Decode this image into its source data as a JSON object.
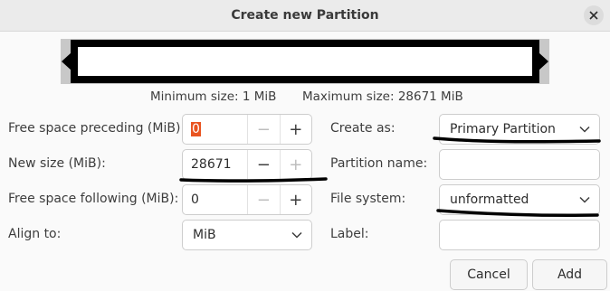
{
  "dialog": {
    "title": "Create new Partition"
  },
  "sizes": {
    "minimum": "Minimum size: 1 MiB",
    "maximum": "Maximum size: 28671 MiB"
  },
  "fields": {
    "free_preceding": {
      "label": "Free space preceding (MiB):",
      "value": "0"
    },
    "new_size": {
      "label": "New size (MiB):",
      "value": "28671"
    },
    "free_following": {
      "label": "Free space following (MiB):",
      "value": "0"
    },
    "align_to": {
      "label": "Align to:",
      "value": "MiB"
    },
    "create_as": {
      "label": "Create as:",
      "value": "Primary Partition"
    },
    "partition_name": {
      "label": "Partition name:",
      "value": ""
    },
    "file_system": {
      "label": "File system:",
      "value": "unformatted"
    },
    "label": {
      "label": "Label:",
      "value": ""
    }
  },
  "buttons": {
    "cancel": "Cancel",
    "add": "Add"
  },
  "icons": {
    "close": "close-icon",
    "minus": "minus-icon",
    "plus": "plus-icon",
    "dropdown": "chevron-down-icon"
  },
  "colors": {
    "selection": "#e95420"
  }
}
